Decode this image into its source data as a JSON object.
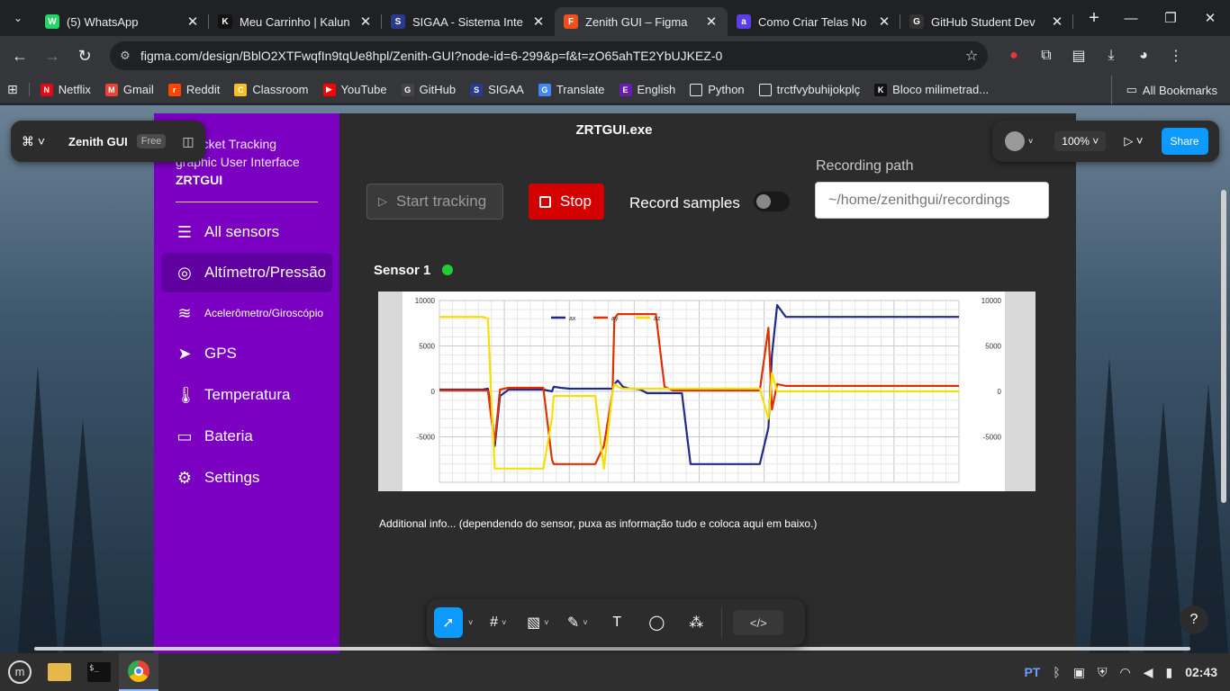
{
  "browser": {
    "tabs": [
      {
        "title": "(5) WhatsApp",
        "icon": "whatsapp-icon",
        "color": "#25d366",
        "glyph": "W"
      },
      {
        "title": "Meu Carrinho | Kalun",
        "icon": "kalunga-icon",
        "color": "#111111",
        "glyph": "K"
      },
      {
        "title": "SIGAA - Sistema Inte",
        "icon": "sigaa-icon",
        "color": "#2b3a8c",
        "glyph": "S"
      },
      {
        "title": "Zenith GUI – Figma",
        "icon": "figma-icon",
        "color": "#f24e1e",
        "glyph": "F"
      },
      {
        "title": "Como Criar Telas No",
        "icon": "a-icon",
        "color": "#5a3ee8",
        "glyph": "a"
      },
      {
        "title": "GitHub Student Dev",
        "icon": "github-icon",
        "color": "#333333",
        "glyph": "G"
      }
    ],
    "active_tab": 3,
    "url": "figma.com/design/BblO2XTFwqfIn9tqUe8hpl/Zenith-GUI?node-id=6-299&p=f&t=zO65ahTE2YbUJKEZ-0",
    "bookmarks": [
      {
        "label": "Netflix",
        "icon": "netflix-icon",
        "color": "#e50914",
        "glyph": "N"
      },
      {
        "label": "Gmail",
        "icon": "gmail-icon",
        "color": "#ea4335",
        "glyph": "M"
      },
      {
        "label": "Reddit",
        "icon": "reddit-icon",
        "color": "#ff4500",
        "glyph": "r"
      },
      {
        "label": "Classroom",
        "icon": "classroom-icon",
        "color": "#f6bf26",
        "glyph": "C"
      },
      {
        "label": "YouTube",
        "icon": "youtube-icon",
        "color": "#ff0000",
        "glyph": "▶"
      },
      {
        "label": "GitHub",
        "icon": "github-icon",
        "color": "#444444",
        "glyph": "G"
      },
      {
        "label": "SIGAA",
        "icon": "sigaa-icon",
        "color": "#2b3a8c",
        "glyph": "S"
      },
      {
        "label": "Translate",
        "icon": "translate-icon",
        "color": "#4285f4",
        "glyph": "G"
      },
      {
        "label": "English",
        "icon": "english-icon",
        "color": "#6a1bb3",
        "glyph": "E"
      },
      {
        "label": "Python",
        "icon": "folder-icon",
        "color": "#35363a",
        "glyph": "▭"
      },
      {
        "label": "trctfvybuhijokplç",
        "icon": "folder-icon",
        "color": "#35363a",
        "glyph": "▭"
      },
      {
        "label": "Bloco milimetrad...",
        "icon": "kalunga-icon",
        "color": "#111111",
        "glyph": "K"
      }
    ],
    "all_bookmarks": "All Bookmarks"
  },
  "figma": {
    "file_name": "Zenith GUI",
    "plan_badge": "Free",
    "zoom": "100%",
    "share_label": "Share",
    "help": "?"
  },
  "app": {
    "frame_title": "ZRTGUI.exe",
    "subtitle": "h Rocket Tracking\ngraphic User Interface",
    "brand": "ZRTGUI",
    "nav": [
      {
        "label": "All sensors",
        "icon": "list-icon",
        "glyph": "☰",
        "active": false,
        "small": false
      },
      {
        "label": "Altímetro/Pressão",
        "icon": "target-icon",
        "glyph": "◎",
        "active": true,
        "small": false
      },
      {
        "label": "Acelerômetro/Giroscópio",
        "icon": "wind-icon",
        "glyph": "≋",
        "active": false,
        "small": true
      },
      {
        "label": "GPS",
        "icon": "location-arrow-icon",
        "glyph": "➤",
        "active": false,
        "small": false
      },
      {
        "label": "Temperatura",
        "icon": "thermometer-icon",
        "glyph": "🌡",
        "active": false,
        "small": false
      },
      {
        "label": "Bateria",
        "icon": "battery-icon",
        "glyph": "▭",
        "active": false,
        "small": false
      },
      {
        "label": "Settings",
        "icon": "gear-icon",
        "glyph": "⚙",
        "active": false,
        "small": false
      }
    ],
    "start_label": "Start tracking",
    "stop_label": "Stop",
    "record_label": "Record samples",
    "record_on": false,
    "recording_path_label": "Recording path",
    "recording_path_placeholder": "~/home/zenithgui/recordings",
    "sensor_label": "Sensor 1",
    "sensor_status_color": "#22cc33",
    "additional_info": "Additional info... (dependendo do sensor, puxa as informação tudo e coloca aqui em baixo.)"
  },
  "chart_data": {
    "type": "line",
    "title": "",
    "ylim": [
      -10000,
      10000
    ],
    "yticks": [
      "10000",
      "5000",
      "0",
      "-5000"
    ],
    "yticks_right": [
      "10000",
      "5000",
      "0",
      "-5000"
    ],
    "grid": true,
    "legend_placement": "top",
    "x": [
      0,
      10,
      20,
      25,
      28,
      30,
      32,
      35,
      40,
      50,
      55,
      60,
      65,
      66,
      70,
      75,
      80,
      85,
      90,
      95,
      100,
      101,
      103,
      106,
      110,
      113,
      116,
      120,
      125,
      130,
      135,
      140,
      145,
      150,
      153,
      156,
      158,
      160,
      162,
      165,
      170,
      175,
      180,
      185,
      190,
      192,
      195,
      200,
      210,
      220,
      230,
      240,
      250,
      260,
      265,
      270,
      275,
      280,
      290,
      300
    ],
    "series": [
      {
        "name": "ax",
        "color": "#1f2a8a",
        "values": [
          200,
          200,
          200,
          200,
          300,
          -2000,
          -6000,
          -500,
          200,
          200,
          200,
          200,
          0,
          500,
          400,
          300,
          300,
          300,
          300,
          300,
          300,
          800,
          1200,
          500,
          300,
          300,
          200,
          -200,
          -200,
          -200,
          -200,
          -200,
          -8000,
          -8000,
          -8000,
          -8000,
          -8000,
          -8000,
          -8000,
          -8000,
          -8000,
          -8000,
          -8000,
          -8000,
          -4000,
          4000,
          9500,
          8200,
          8200,
          8200,
          8200,
          8200,
          8200,
          8200,
          8200,
          8200,
          8200,
          8200,
          8200,
          8200
        ]
      },
      {
        "name": "ay",
        "color": "#e03000",
        "values": [
          100,
          100,
          100,
          100,
          100,
          -3000,
          -5500,
          200,
          400,
          400,
          400,
          400,
          -7500,
          -8000,
          -8000,
          -8000,
          -8000,
          -8000,
          -8000,
          -6000,
          0,
          8000,
          8500,
          8500,
          8500,
          8500,
          8500,
          8500,
          8500,
          500,
          100,
          100,
          100,
          100,
          100,
          100,
          100,
          100,
          100,
          100,
          100,
          100,
          100,
          100,
          7000,
          -2000,
          800,
          600,
          600,
          600,
          600,
          600,
          600,
          600,
          600,
          600,
          600,
          600,
          600,
          600
        ]
      },
      {
        "name": "az",
        "color": "#f5e000",
        "values": [
          8200,
          8200,
          8200,
          8200,
          8000,
          -1000,
          -8500,
          -8500,
          -8500,
          -8500,
          -8500,
          -8500,
          -3000,
          -500,
          -500,
          -500,
          -500,
          -500,
          -500,
          -8500,
          0,
          800,
          500,
          300,
          300,
          300,
          300,
          300,
          300,
          300,
          300,
          300,
          300,
          300,
          300,
          300,
          300,
          300,
          300,
          300,
          300,
          300,
          300,
          300,
          -3000,
          2000,
          0,
          0,
          0,
          0,
          0,
          0,
          0,
          0,
          0,
          0,
          0,
          0,
          0,
          0
        ]
      }
    ]
  },
  "taskbar": {
    "items": [
      {
        "icon": "mint-menu-icon",
        "glyph": "ⓜ"
      },
      {
        "icon": "files-folder-icon",
        "glyph": "▬"
      },
      {
        "icon": "terminal-icon",
        "glyph": "$_"
      },
      {
        "icon": "chrome-icon",
        "glyph": "◉"
      }
    ],
    "lang": "PT",
    "time": "02:43"
  }
}
